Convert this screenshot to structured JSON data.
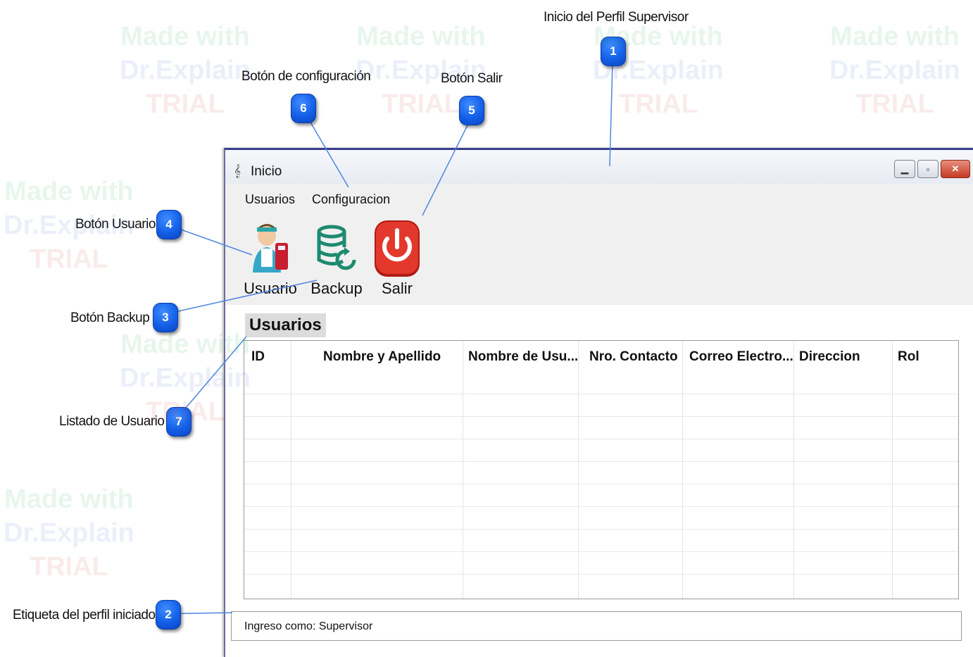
{
  "callouts": [
    {
      "num": "1",
      "label": "Inicio del Perfil Supervisor"
    },
    {
      "num": "2",
      "label": "Etiqueta del perfil iniciado"
    },
    {
      "num": "3",
      "label": "Botón Backup"
    },
    {
      "num": "4",
      "label": "Botón Usuario"
    },
    {
      "num": "5",
      "label": "Botón Salir"
    },
    {
      "num": "6",
      "label": "Botón de configuración"
    },
    {
      "num": "7",
      "label": "Listado de Usuario"
    }
  ],
  "watermark": {
    "line1": "Made with",
    "line2": "Dr.Explain",
    "line3": "TRIAL"
  },
  "window": {
    "title": "Inicio",
    "menu": [
      "Usuarios",
      "Configuracion"
    ],
    "toolbar": [
      {
        "label": "Usuario",
        "icon": "user-icon"
      },
      {
        "label": "Backup",
        "icon": "database-restore-icon"
      },
      {
        "label": "Salir",
        "icon": "power-icon"
      }
    ],
    "section_title": "Usuarios",
    "columns": [
      "ID",
      "Nombre y Apellido",
      "Nombre de Usu...",
      "Nro. Contacto",
      "Correo Electro...",
      "Direccion",
      "Rol"
    ],
    "status": "Ingreso como: Supervisor"
  },
  "colors": {
    "badge": "#1460e8",
    "window_border": "#3a3e8c",
    "close_button": "#c43a22",
    "power_button": "#d62a20"
  }
}
